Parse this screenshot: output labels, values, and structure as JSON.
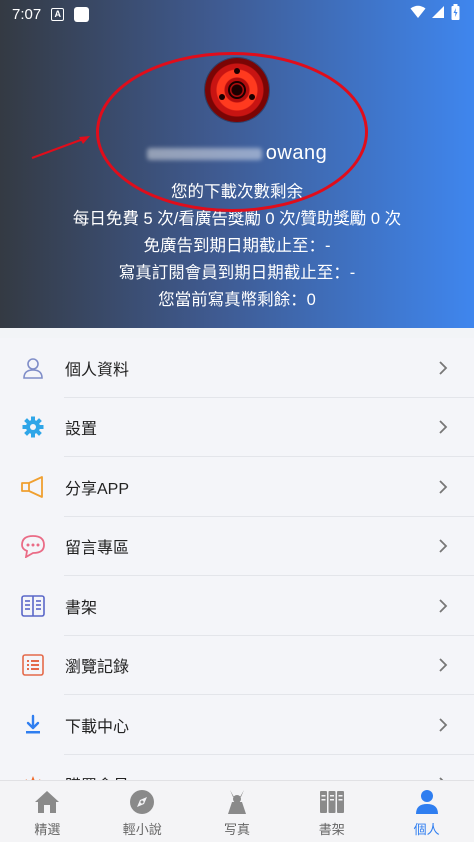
{
  "status_bar": {
    "time": "7:07",
    "a_icon": "A"
  },
  "profile": {
    "username_suffix": "owang",
    "lines": [
      "您的下載次數剩余",
      "每日免費 5 次/看廣告獎勵 0 次/贊助獎勵 0 次",
      "免廣告到期日期截止至：-",
      "寫真訂閱會員到期日期截止至：-",
      "您當前寫真幣剩餘：0"
    ]
  },
  "menu": {
    "items": [
      {
        "label": "個人資料",
        "icon": "user-icon"
      },
      {
        "label": "設置",
        "icon": "gear-icon"
      },
      {
        "label": "分享APP",
        "icon": "megaphone-icon"
      },
      {
        "label": "留言專區",
        "icon": "chat-bubble-icon"
      },
      {
        "label": "書架",
        "icon": "bookshelf-icon"
      },
      {
        "label": "瀏覽記錄",
        "icon": "history-list-icon"
      },
      {
        "label": "下載中心",
        "icon": "download-icon"
      },
      {
        "label": "購買會員",
        "icon": "crown-icon"
      }
    ]
  },
  "bottom_nav": {
    "items": [
      {
        "label": "精選",
        "icon": "home-icon",
        "active": false
      },
      {
        "label": "輕小說",
        "icon": "compass-icon",
        "active": false
      },
      {
        "label": "写真",
        "icon": "figure-icon",
        "active": false
      },
      {
        "label": "書架",
        "icon": "books-icon",
        "active": false
      },
      {
        "label": "個人",
        "icon": "person-icon",
        "active": true
      }
    ]
  },
  "colors": {
    "accent": "#2f7ef0",
    "annotation": "#e00d1b"
  }
}
